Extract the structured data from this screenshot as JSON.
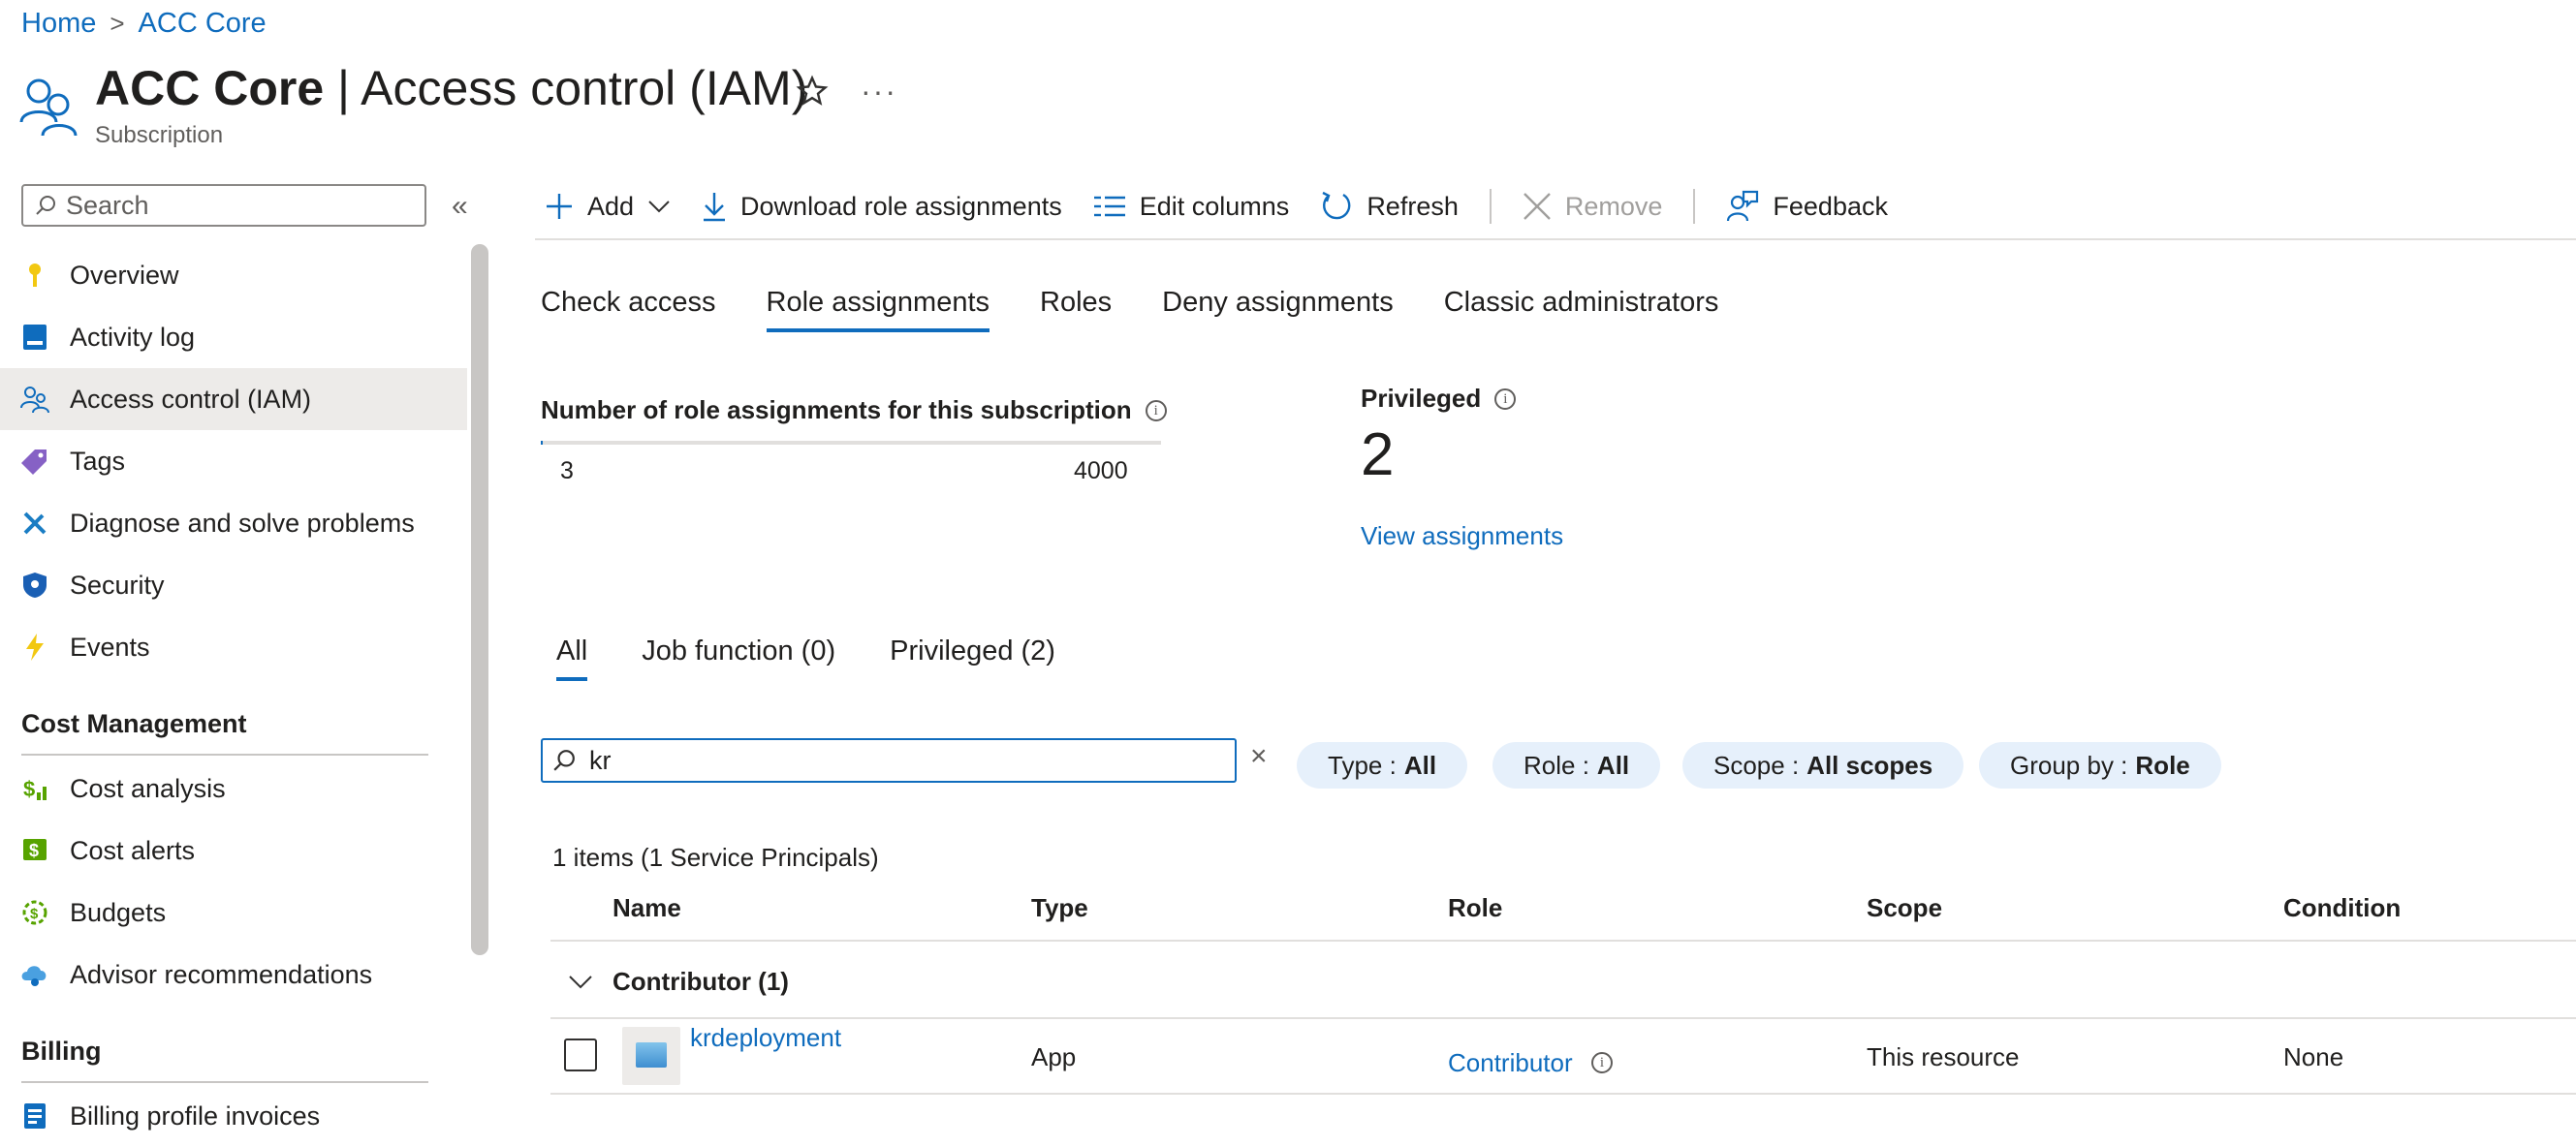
{
  "breadcrumb": {
    "home": "Home",
    "current": "ACC Core",
    "sep": ">"
  },
  "header": {
    "title_strong": "ACC Core",
    "title_rest": " | Access control (IAM)",
    "subtitle": "Subscription",
    "more": "···"
  },
  "sidebar": {
    "search_placeholder": "Search",
    "collapse": "«",
    "items": [
      {
        "label": "Overview",
        "icon": "key-icon"
      },
      {
        "label": "Activity log",
        "icon": "activity-log-icon"
      },
      {
        "label": "Access control (IAM)",
        "icon": "people-icon",
        "selected": true
      },
      {
        "label": "Tags",
        "icon": "tag-icon"
      },
      {
        "label": "Diagnose and solve problems",
        "icon": "wrench-icon"
      },
      {
        "label": "Security",
        "icon": "shield-icon"
      },
      {
        "label": "Events",
        "icon": "lightning-icon"
      }
    ],
    "sections": {
      "cost": "Cost Management",
      "billing": "Billing"
    },
    "cost_items": [
      {
        "label": "Cost analysis",
        "icon": "cost-analysis-icon"
      },
      {
        "label": "Cost alerts",
        "icon": "cost-alerts-icon"
      },
      {
        "label": "Budgets",
        "icon": "budgets-icon"
      },
      {
        "label": "Advisor recommendations",
        "icon": "advisor-icon"
      }
    ],
    "billing_items": [
      {
        "label": "Billing profile invoices",
        "icon": "invoice-icon"
      }
    ]
  },
  "toolbar": {
    "add": "Add",
    "download": "Download role assignments",
    "edit_columns": "Edit columns",
    "refresh": "Refresh",
    "remove": "Remove",
    "feedback": "Feedback"
  },
  "tabs": [
    "Check access",
    "Role assignments",
    "Roles",
    "Deny assignments",
    "Classic administrators"
  ],
  "stats": {
    "label": "Number of role assignments for this subscription",
    "current": "3",
    "max": "4000",
    "fill_fraction": 0.00075,
    "privileged_label": "Privileged",
    "privileged_count": "2",
    "view_link": "View assignments"
  },
  "subtabs": [
    "All",
    "Job function (0)",
    "Privileged (2)"
  ],
  "filter": {
    "value": "kr",
    "clear": "×",
    "pills": [
      {
        "key": "Type :",
        "value": "All"
      },
      {
        "key": "Role :",
        "value": "All"
      },
      {
        "key": "Scope :",
        "value": "All scopes"
      },
      {
        "key": "Group by :",
        "value": "Role"
      }
    ]
  },
  "grid": {
    "count": "1 items (1 Service Principals)",
    "columns": [
      "Name",
      "Type",
      "Role",
      "Scope",
      "Condition"
    ],
    "group": "Contributor (1)",
    "rows": [
      {
        "name": "krdeployment",
        "type": "App",
        "role": "Contributor",
        "scope": "This resource",
        "condition": "None"
      }
    ]
  },
  "colors": {
    "accent": "#0f6cbd",
    "pill_bg": "#e6f0fb",
    "selected_bg": "#edebe9"
  }
}
